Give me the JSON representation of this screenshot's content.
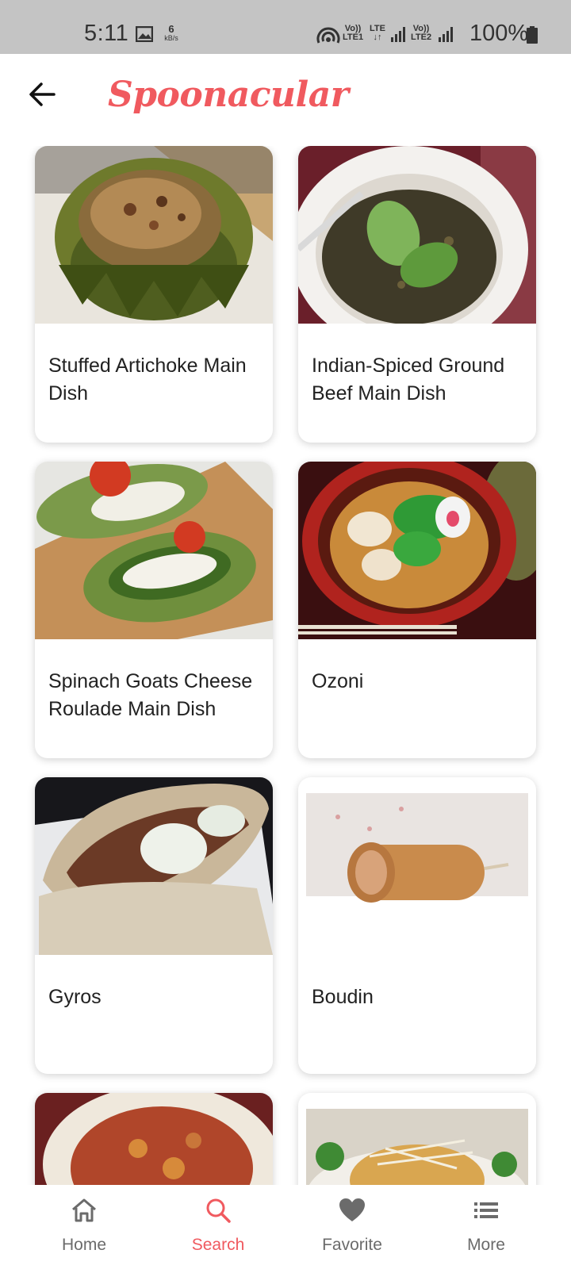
{
  "status_bar": {
    "time": "5:11",
    "speed_value": "6",
    "speed_unit": "kB/s",
    "sim1_top": "Vo))",
    "sim1_bottom": "LTE1",
    "lte_label": "LTE",
    "sim2_top": "Vo))",
    "sim2_bottom": "LTE2",
    "battery": "100%"
  },
  "app_bar": {
    "title": "Spoonacular"
  },
  "recipes": [
    {
      "title": "Stuffed Artichoke Main Dish"
    },
    {
      "title": "Indian-Spiced Ground Beef Main Dish"
    },
    {
      "title": "Spinach Goats Cheese Roulade Main Dish"
    },
    {
      "title": "Ozoni"
    },
    {
      "title": "Gyros"
    },
    {
      "title": "Boudin"
    }
  ],
  "bottom_nav": {
    "items": [
      {
        "label": "Home",
        "icon": "home-icon"
      },
      {
        "label": "Search",
        "icon": "search-icon"
      },
      {
        "label": "Favorite",
        "icon": "heart-icon"
      },
      {
        "label": "More",
        "icon": "list-icon"
      }
    ],
    "active": "Search",
    "active_color": "#f05a5f",
    "inactive_color": "#6b6b6b"
  },
  "colors": {
    "brand": "#f05a5f",
    "status_bar": "#c4c4c4"
  }
}
